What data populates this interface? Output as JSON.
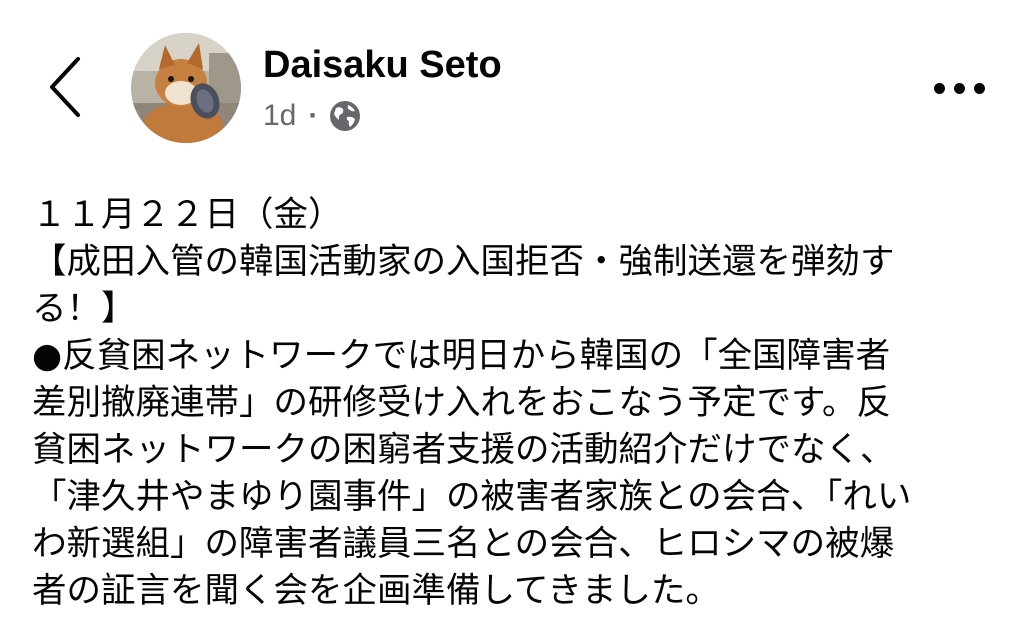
{
  "header": {
    "back_icon": "chevron-left-icon",
    "author_name": "Daisaku Seto",
    "timestamp": "1d",
    "separator": "·",
    "audience_icon": "globe-icon",
    "more_icon": "more-horizontal-icon"
  },
  "post": {
    "lines": [
      "１１月２２日（金）",
      "【成田入管の韓国活動家の入国拒否・強制送還を弾劾す",
      "る！】",
      "●反貧困ネットワークでは明日から韓国の「全国障害者",
      "差別撤廃連帯」の研修受け入れをおこなう予定です。反",
      "貧困ネットワークの困窮者支援の活動紹介だけでなく、",
      "「津久井やまゆり園事件」の被害者家族との会合、「れい",
      "わ新選組」の障害者議員三名との会合、ヒロシマの被爆",
      "者の証言を聞く会を企画準備してきました。"
    ]
  },
  "colors": {
    "text": "#050505",
    "secondary_text": "#65676b",
    "background": "#ffffff"
  }
}
